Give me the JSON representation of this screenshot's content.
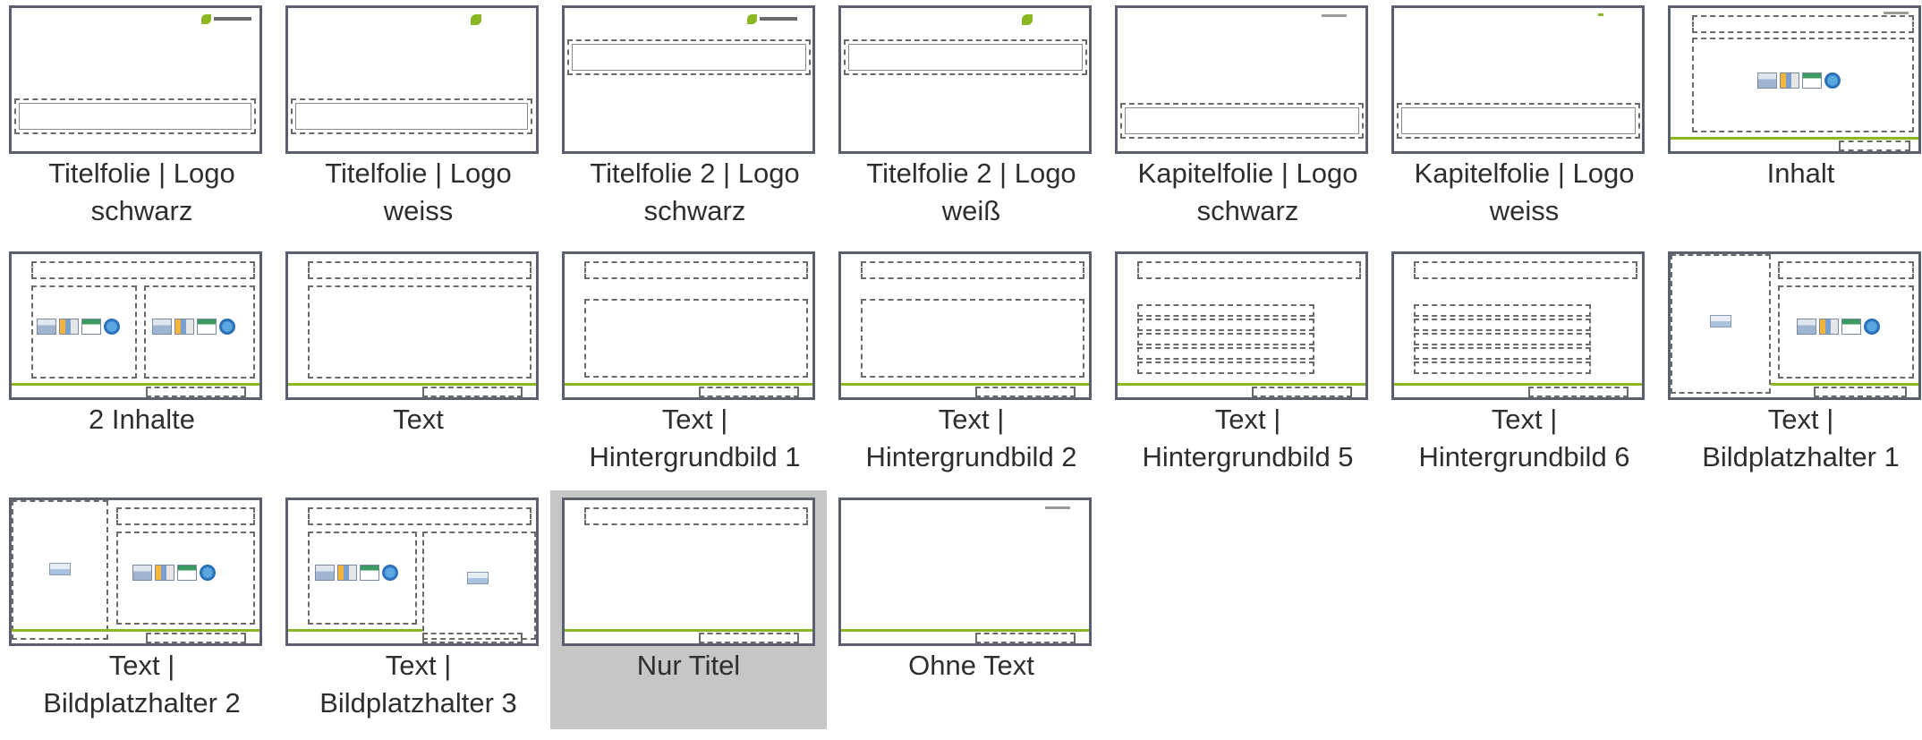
{
  "layouts": [
    {
      "label": "Titelfolie | Logo\nschwarz",
      "selected": false
    },
    {
      "label": "Titelfolie | Logo\nweiss",
      "selected": false
    },
    {
      "label": "Titelfolie 2 | Logo\nschwarz",
      "selected": false
    },
    {
      "label": "Titelfolie 2 | Logo\nweiß",
      "selected": false
    },
    {
      "label": "Kapitelfolie |  Logo\nschwarz",
      "selected": false
    },
    {
      "label": "Kapitelfolie | Logo\nweiss",
      "selected": false
    },
    {
      "label": "Inhalt",
      "selected": false
    },
    {
      "label": "2 Inhalte",
      "selected": false
    },
    {
      "label": "Text",
      "selected": false
    },
    {
      "label": "Text |\nHintergrundbild 1",
      "selected": false
    },
    {
      "label": "Text |\nHintergrundbild 2",
      "selected": false
    },
    {
      "label": "Text |\nHintergrundbild 5",
      "selected": false
    },
    {
      "label": "Text |\nHintergrundbild 6",
      "selected": false
    },
    {
      "label": "Text |\nBildplatzhalter 1",
      "selected": false
    },
    {
      "label": "Text |\nBildplatzhalter 2",
      "selected": false
    },
    {
      "label": "Text |\nBildplatzhalter 3",
      "selected": false
    },
    {
      "label": "Nur Titel",
      "selected": true
    },
    {
      "label": "Ohne Text",
      "selected": false
    }
  ],
  "colors": {
    "accent_green": "#8bb821",
    "thumbnail_border": "#5a6070",
    "selected_background": "#c6c6c6",
    "label_text": "#2e2e2e"
  },
  "icons": {
    "brand_logo": "leaf-logo-icon",
    "content_placeholder": "insert-content-icons",
    "picture_placeholder": "picture-icon"
  }
}
